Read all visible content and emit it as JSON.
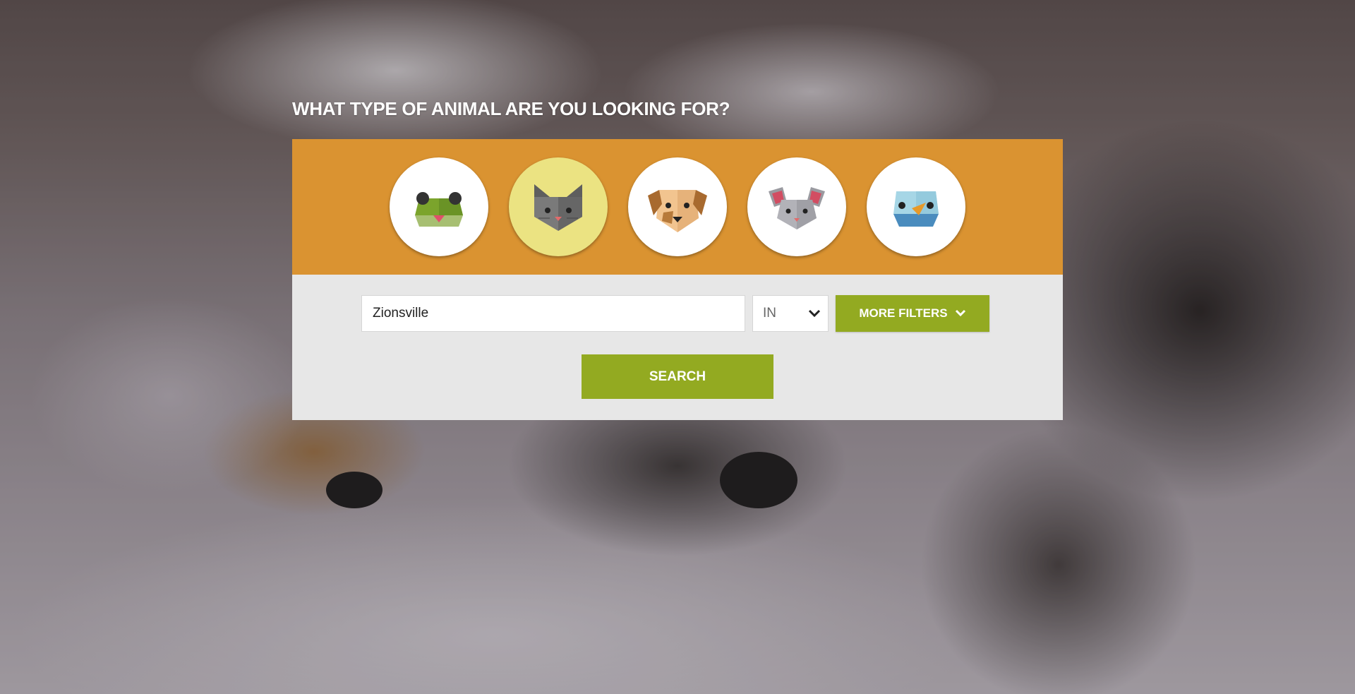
{
  "heading": "WHAT TYPE OF ANIMAL ARE YOU LOOKING FOR?",
  "animals": [
    {
      "icon": "frog-icon",
      "selected": false
    },
    {
      "icon": "cat-icon",
      "selected": true
    },
    {
      "icon": "dog-icon",
      "selected": false
    },
    {
      "icon": "mouse-icon",
      "selected": false
    },
    {
      "icon": "bird-icon",
      "selected": false
    }
  ],
  "search_form": {
    "city_value": "Zionsville",
    "state_value": "IN",
    "more_filters_label": "MORE FILTERS",
    "search_label": "SEARCH"
  },
  "colors": {
    "panel_accent": "#da9331",
    "button_green": "#93aa21",
    "selected_circle": "#ebe382",
    "form_background": "#e7e7e7"
  }
}
